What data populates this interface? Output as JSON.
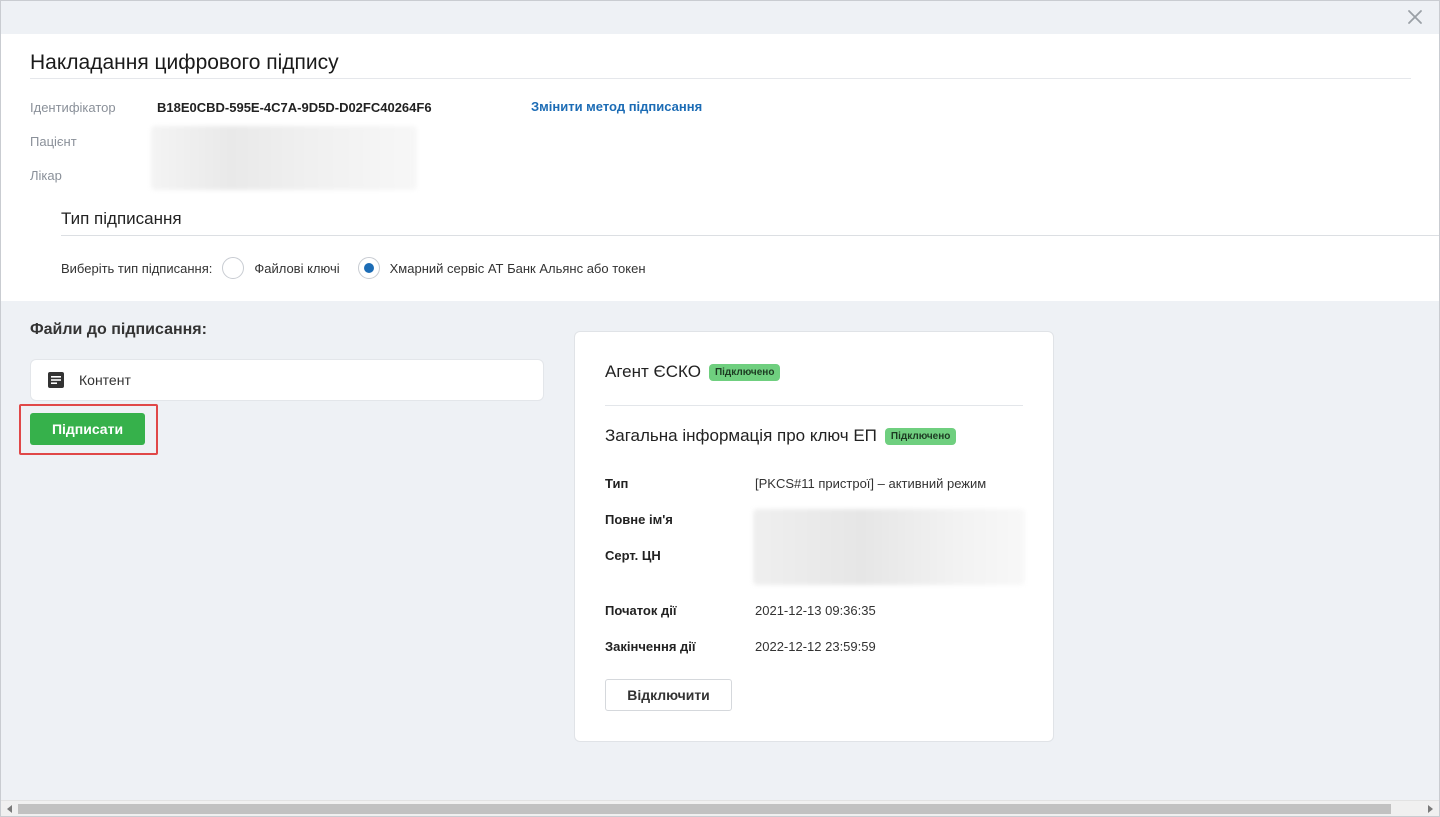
{
  "dialog": {
    "title": "Накладання цифрового підпису",
    "close_icon": "close-icon"
  },
  "meta": {
    "identifier_label": "Ідентифікатор",
    "identifier_value": "B18E0CBD-595E-4C7A-9D5D-D02FC40264F6",
    "patient_label": "Пацієнт",
    "doctor_label": "Лікар",
    "change_method_link": "Змінити метод підписання"
  },
  "signing_type": {
    "section_title": "Тип підписання",
    "prompt": "Виберіть тип підписання:",
    "options": [
      {
        "label": "Файлові ключі",
        "selected": false
      },
      {
        "label": "Хмарний сервіс АТ Банк Альянс або токен",
        "selected": true
      }
    ]
  },
  "files": {
    "title": "Файли до підписання:",
    "items": [
      {
        "label": "Контент",
        "icon": "document-icon"
      }
    ],
    "sign_button": "Підписати"
  },
  "agent_card": {
    "agent_title": "Агент ЄСКО",
    "agent_status": "Підключено",
    "key_title": "Загальна інформація про ключ ЕП",
    "key_status": "Підключено",
    "fields": {
      "type_label": "Тип",
      "type_value": "[PKCS#11 пристрої] – активний режим",
      "full_name_label": "Повне ім'я",
      "cert_label": "Серт. ЦН",
      "start_label": "Початок дії",
      "start_value": "2021-12-13 09:36:35",
      "end_label": "Закінчення дії",
      "end_value": "2022-12-12 23:59:59"
    },
    "disconnect_button": "Відключити"
  },
  "colors": {
    "accent_blue": "#1c6cb5",
    "sign_green": "#36b14b",
    "badge_green": "#6fcf7f",
    "highlight_red": "#e04848"
  }
}
